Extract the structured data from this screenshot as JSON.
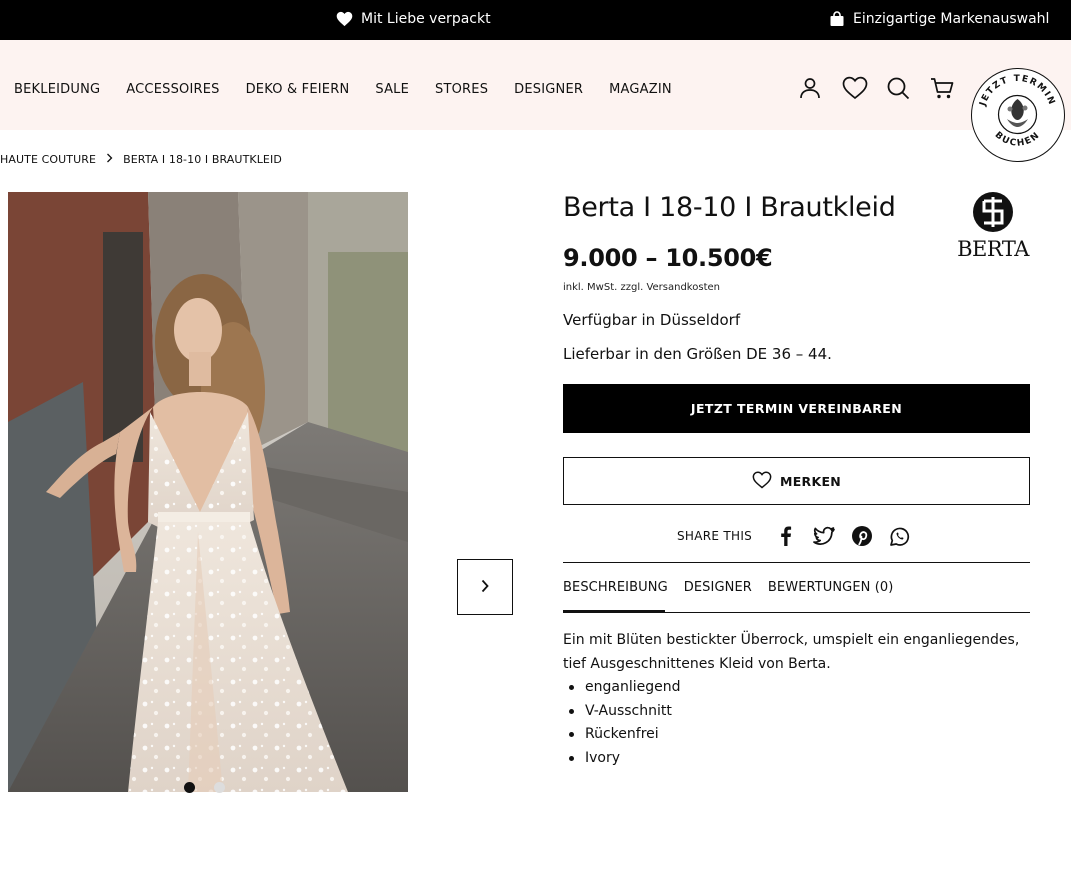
{
  "topbar": {
    "left_text": "Mit Liebe verpackt",
    "left_icon": "heart-icon",
    "right_text": "Einzigartige Markenauswahl",
    "right_icon": "shopping-bag-icon"
  },
  "nav": {
    "items": [
      "BEKLEIDUNG",
      "ACCESSOIRES",
      "DEKO & FEIERN",
      "SALE",
      "STORES",
      "DESIGNER",
      "MAGAZIN"
    ],
    "icons": [
      "user-icon",
      "heart-icon",
      "search-icon",
      "cart-icon"
    ],
    "badge_text": "JETZT TERMIN BUCHEN"
  },
  "breadcrumb": [
    "HAUTE COUTURE",
    "BERTA I 18-10 I BRAUTKLEID"
  ],
  "product": {
    "title": "Berta I 18-10 I Brautkleid",
    "brand": "BERTA",
    "price": "9.000 – 10.500€",
    "tax_note": "inkl. MwSt. zzgl. Versandkosten",
    "availability": "Verfügbar in Düsseldorf",
    "sizes": "Lieferbar in den Größen DE 36 – 44.",
    "cta_label": "JETZT TERMIN VEREINBAREN",
    "wishlist_label": "MERKEN",
    "share_label": "SHARE THIS",
    "share_icons": [
      "facebook-icon",
      "twitter-icon",
      "pinterest-icon",
      "whatsapp-icon"
    ]
  },
  "gallery": {
    "image_count": 2,
    "active_index": 0
  },
  "tabs": {
    "items": [
      "BESCHREIBUNG",
      "DESIGNER",
      "BEWERTUNGEN (0)"
    ],
    "active_index": 0
  },
  "description": {
    "text": "Ein mit Blüten bestickter Überrock, umspielt ein enganliegendes, tief Ausgeschnittenes Kleid von Berta.",
    "bullets": [
      "enganliegend",
      "V-Ausschnitt",
      "Rückenfrei",
      "Ivory"
    ]
  },
  "colors": {
    "topbar_bg": "#000000",
    "nav_bg": "#fdf3f1",
    "cta_bg": "#000000",
    "dot_active": "#111111",
    "dot_inactive": "#dddddd"
  }
}
